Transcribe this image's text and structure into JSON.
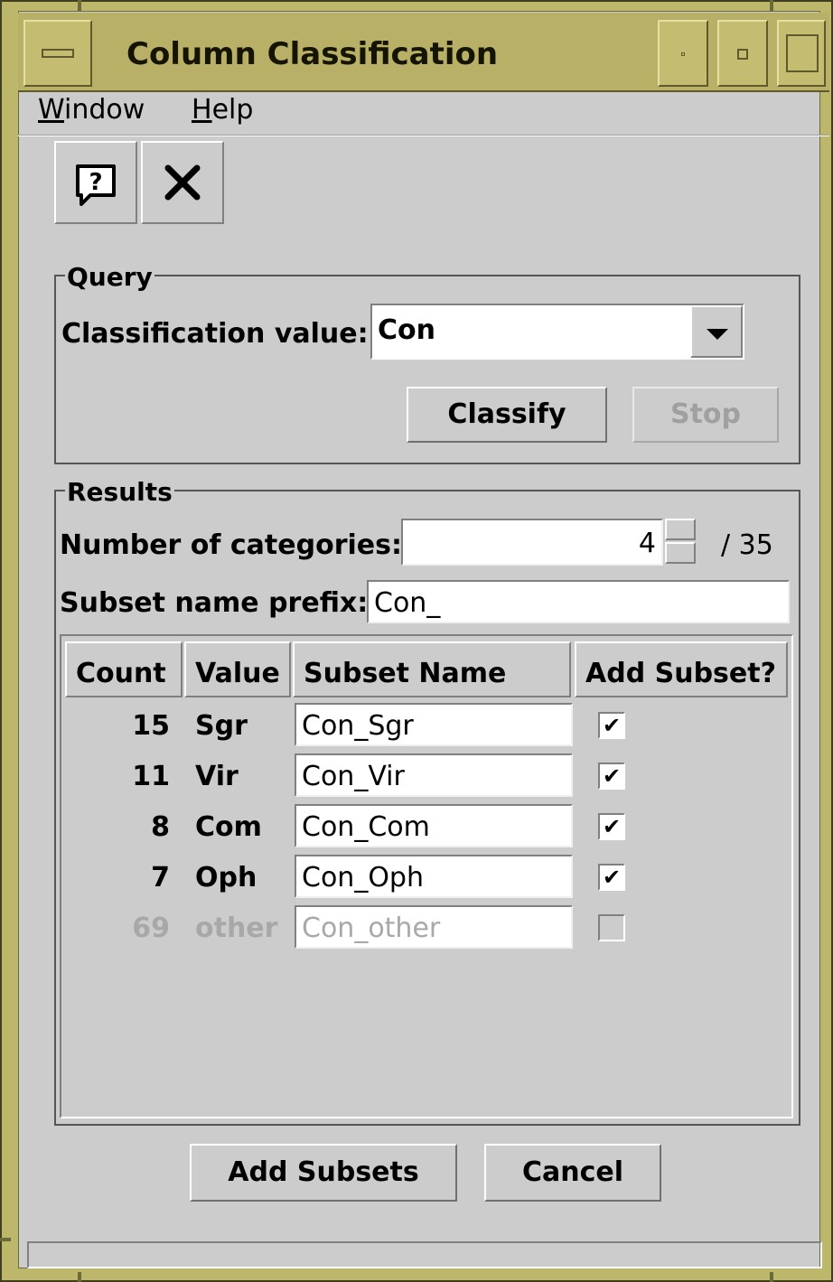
{
  "window": {
    "title": "Column Classification"
  },
  "menu": {
    "window_label_first": "W",
    "window_label_rest": "indow",
    "help_label_first": "H",
    "help_label_rest": "elp"
  },
  "toolbar": {
    "help_icon": "help-bubble-icon",
    "close_icon": "close-x-icon",
    "close_glyph": "✕",
    "help_glyph": "?"
  },
  "query": {
    "group_title": "Query",
    "classification_label": "Classification value:",
    "classification_value": "Con",
    "classify_label": "Classify",
    "stop_label": "Stop"
  },
  "results": {
    "group_title": "Results",
    "num_categories_label": "Number of categories:",
    "num_categories_value": "4",
    "num_categories_total": "/ 35",
    "prefix_label": "Subset name prefix:",
    "prefix_value": "Con_",
    "columns": [
      "Count",
      "Value",
      "Subset Name",
      "Add Subset?"
    ],
    "rows": [
      {
        "count": "15",
        "value": "Sgr",
        "subset_name": "Con_Sgr",
        "add": true,
        "enabled": true
      },
      {
        "count": "11",
        "value": "Vir",
        "subset_name": "Con_Vir",
        "add": true,
        "enabled": true
      },
      {
        "count": "8",
        "value": "Com",
        "subset_name": "Con_Com",
        "add": true,
        "enabled": true
      },
      {
        "count": "7",
        "value": "Oph",
        "subset_name": "Con_Oph",
        "add": true,
        "enabled": true
      },
      {
        "count": "69",
        "value": "other",
        "subset_name": "Con_other",
        "add": false,
        "enabled": false
      }
    ],
    "check_glyph": "✔"
  },
  "footer": {
    "add_subsets_label": "Add Subsets",
    "cancel_label": "Cancel"
  },
  "colors": {
    "frame": "#bdb76b",
    "panel": "#cccccc"
  }
}
